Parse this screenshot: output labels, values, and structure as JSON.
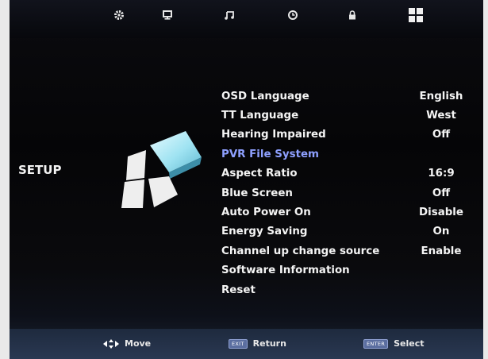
{
  "tabs": [
    {
      "name": "picture-gear-icon",
      "active": false
    },
    {
      "name": "monitor-icon",
      "active": false
    },
    {
      "name": "music-note-icon",
      "active": false
    },
    {
      "name": "clock-icon",
      "active": false
    },
    {
      "name": "lock-icon",
      "active": false
    },
    {
      "name": "setup-grid-icon",
      "active": true
    }
  ],
  "section_title": "SETUP",
  "menu": [
    {
      "label": "OSD Language",
      "value": "English"
    },
    {
      "label": "TT Language",
      "value": "West"
    },
    {
      "label": "Hearing Impaired",
      "value": "Off"
    },
    {
      "label": "PVR File System",
      "value": ""
    },
    {
      "label": "Aspect Ratio",
      "value": "16:9"
    },
    {
      "label": "Blue Screen",
      "value": "Off"
    },
    {
      "label": "Auto Power On",
      "value": "Disable"
    },
    {
      "label": "Energy Saving",
      "value": "On"
    },
    {
      "label": "Channel up change source",
      "value": "Enable"
    },
    {
      "label": "Software Information",
      "value": ""
    },
    {
      "label": "Reset",
      "value": ""
    }
  ],
  "selected_index": 3,
  "colors": {
    "selected_text": "#8ea0ff",
    "text": "#f4f4f4",
    "bar": "#2a3852"
  },
  "footer": {
    "move_label": "Move",
    "exit_key": "EXIT",
    "return_label": "Return",
    "enter_key": "ENTER",
    "select_label": "Select"
  }
}
